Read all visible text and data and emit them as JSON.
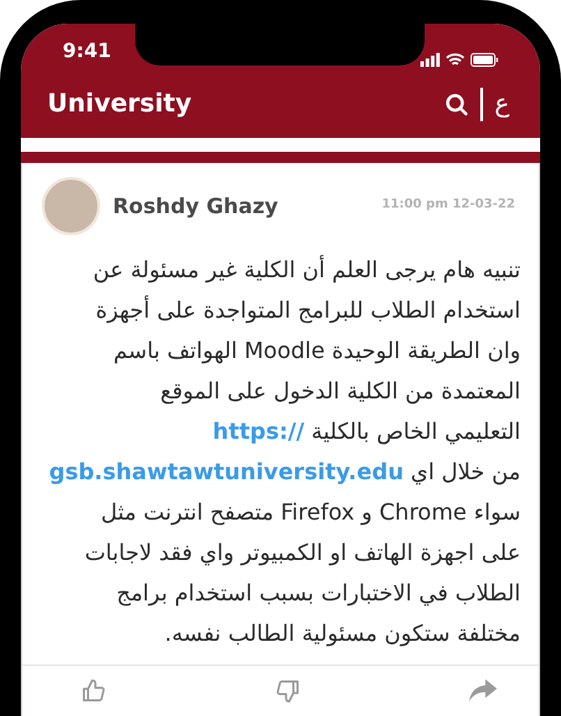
{
  "status_bar": {
    "time": "9:41"
  },
  "header": {
    "title": "University",
    "language_toggle": "ع"
  },
  "post": {
    "author": "Roshdy Ghazy",
    "timestamp": "11:00 pm 12-03-22",
    "lines": [
      [
        {
          "text": "تنبيه هام يرجى العلم أن الكلية غير مسئولة عن"
        }
      ],
      [
        {
          "text": "استخدام الطلاب للبرامج المتواجدة على أجهزة"
        }
      ],
      [
        {
          "text": "وان الطريقة الوحيدة Moodle الهواتف باسم"
        }
      ],
      [
        {
          "text": "المعتمدة من الكلية الدخول على الموقع"
        }
      ],
      [
        {
          "text": "التعليمي الخاص بالكلية "
        },
        {
          "text": "https://",
          "kind": "link"
        }
      ],
      [
        {
          "text": "من خلال اي "
        },
        {
          "text": "gsb.shawtawtuniversity.edu",
          "kind": "link"
        }
      ],
      [
        {
          "text": "سواء Chrome و Firefox متصفح انترنت مثل"
        }
      ],
      [
        {
          "text": "على اجهزة الهاتف او الكمبيوتر واي فقد لاجابات"
        }
      ],
      [
        {
          "text": "الطلاب في الاختبارات بسبب استخدام برامج"
        }
      ],
      [
        {
          "text": "مختلفة ستكون مسئولية الطالب نفسه."
        }
      ]
    ]
  }
}
